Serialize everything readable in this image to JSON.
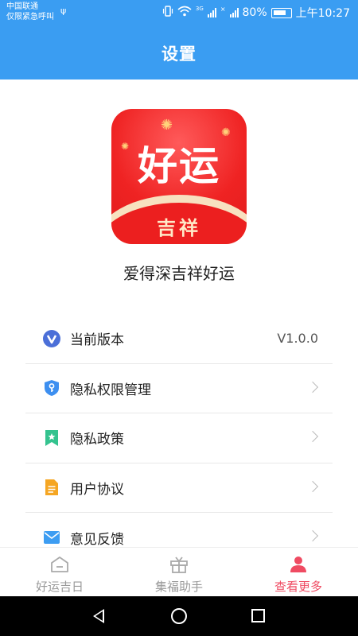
{
  "status_bar": {
    "carrier_line1": "中国联通",
    "carrier_line2": "仅限紧急呼叫",
    "network_badge_1": "3G",
    "network_badge_2": "×",
    "battery": "80%",
    "time": "上午10:27"
  },
  "header": {
    "title": "设置"
  },
  "app": {
    "logo_main": "好运",
    "logo_sub": "吉祥",
    "name": "爱得深吉祥好运"
  },
  "settings": [
    {
      "label": "当前版本",
      "value": "V1.0.0",
      "icon": "v-logo-icon"
    },
    {
      "label": "隐私权限管理",
      "icon": "shield-key-icon"
    },
    {
      "label": "隐私政策",
      "icon": "bookmark-star-icon"
    },
    {
      "label": "用户协议",
      "icon": "document-icon"
    },
    {
      "label": "意见反馈",
      "icon": "mail-icon"
    }
  ],
  "tabs": [
    {
      "label": "好运吉日",
      "icon": "home-icon",
      "active": false
    },
    {
      "label": "集福助手",
      "icon": "gift-icon",
      "active": false
    },
    {
      "label": "查看更多",
      "icon": "user-icon",
      "active": true
    }
  ],
  "colors": {
    "header_bg": "#3a9df2",
    "active_tab": "#ef4b62",
    "logo_red": "#ef2323"
  }
}
